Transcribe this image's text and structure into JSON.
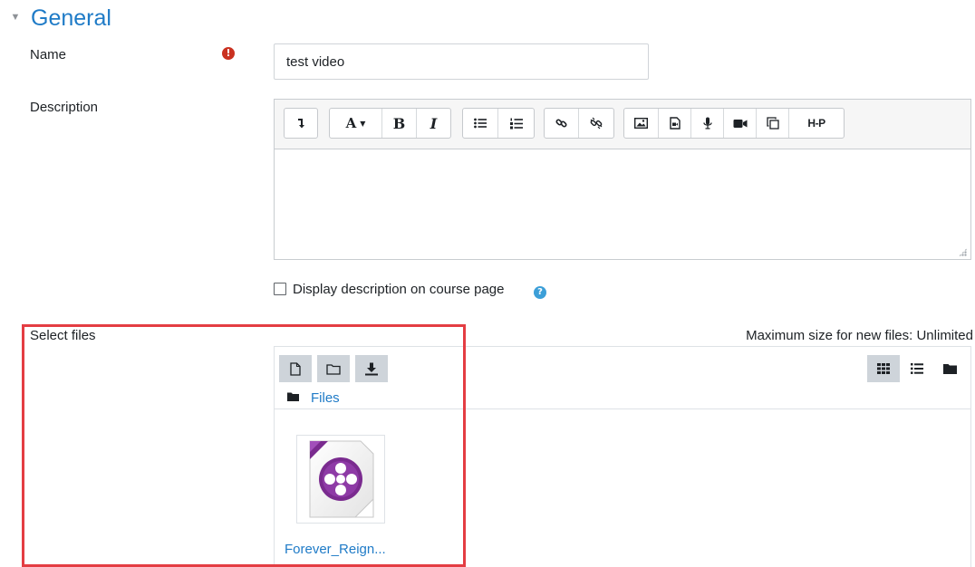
{
  "section": {
    "title": "General",
    "toggle_glyph": "▼"
  },
  "name_field": {
    "label": "Name",
    "required_glyph": "!",
    "value": "test video"
  },
  "description": {
    "label": "Description",
    "toolbar_groups": [
      [
        "toolbar-toggle"
      ],
      [
        "font-color",
        "bold",
        "italic"
      ],
      [
        "unordered-list",
        "ordered-list"
      ],
      [
        "link",
        "unlink"
      ],
      [
        "image",
        "media",
        "record-audio",
        "record-video",
        "manage-files",
        "h5p"
      ]
    ],
    "bold_label": "B",
    "italic_label": "I",
    "font_label": "A",
    "h5p_label": "H-P"
  },
  "display_description": {
    "label": "Display description on course page",
    "checked": false,
    "help_glyph": "?"
  },
  "files": {
    "label": "Select files",
    "max_size_text": "Maximum size for new files: Unlimited",
    "path_link": "Files",
    "file_name": "Forever_Reign...",
    "active_view": "icons"
  },
  "colors": {
    "accent": "#1f7bc7",
    "highlight": "#e43d43",
    "required": "#ca3120",
    "file_icon": "#7a2b8f"
  }
}
